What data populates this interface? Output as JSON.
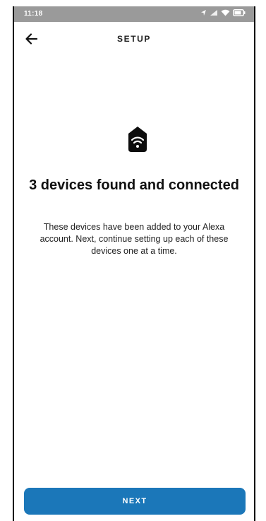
{
  "status_bar": {
    "time": "11:18",
    "icons": [
      "location-icon",
      "signal-icon",
      "wifi-icon",
      "battery-icon"
    ]
  },
  "header": {
    "title": "SETUP",
    "back_icon": "back-arrow-icon"
  },
  "main": {
    "icon": "smart-home-hub-icon",
    "heading": "3 devices found and connected",
    "body": "These devices have been added to your Alexa account. Next, continue setting up each of these devices one at a time."
  },
  "footer": {
    "next_label": "NEXT"
  },
  "colors": {
    "status_bar": "#9a9a9a",
    "accent": "#1b77b9",
    "text": "#111111"
  }
}
